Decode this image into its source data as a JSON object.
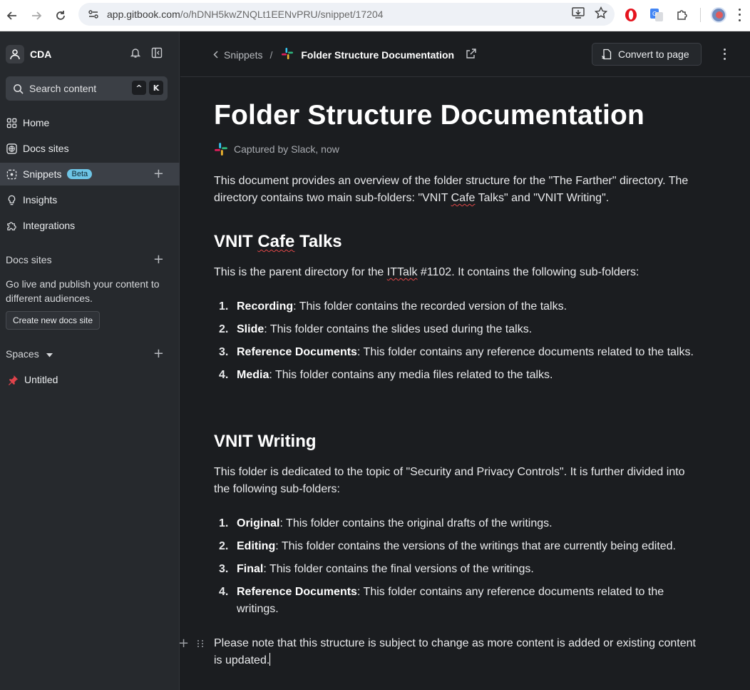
{
  "browser": {
    "url_host": "app.gitbook.com",
    "url_path": "/o/hDNH5kwZNQLt1EENvPRU/snippet/17204"
  },
  "sidebar": {
    "org_name": "CDA",
    "search_placeholder": "Search content",
    "search_kbd": [
      "^",
      "K"
    ],
    "nav": [
      {
        "label": "Home",
        "icon": "grid-icon"
      },
      {
        "label": "Docs sites",
        "icon": "globe-icon"
      },
      {
        "label": "Snippets",
        "icon": "snippet-icon",
        "badge": "Beta",
        "active": true
      },
      {
        "label": "Insights",
        "icon": "lightbulb-icon"
      },
      {
        "label": "Integrations",
        "icon": "puzzle-icon"
      }
    ],
    "docs_sites_heading": "Docs sites",
    "docs_sites_desc": "Go live and publish your content to different audiences.",
    "create_docs_site": "Create new docs site",
    "spaces_heading": "Spaces",
    "spaces": [
      {
        "label": "Untitled",
        "icon": "pushpin-icon"
      }
    ]
  },
  "topbar": {
    "breadcrumb_parent": "Snippets",
    "breadcrumb_sep": "/",
    "breadcrumb_current": "Folder Structure Documentation",
    "convert_label": "Convert to page"
  },
  "doc": {
    "title": "Folder Structure Documentation",
    "meta": "Captured by Slack, now",
    "intro_a": "This document provides an overview of the folder structure for the \"The Farther\" directory.",
    "intro_b_pre": "The directory contains two main sub-folders: \"VNIT ",
    "intro_b_sq": "Cafe",
    "intro_b_post": " Talks\" and \"VNIT Writing\".",
    "h_cafe_pre": "VNIT ",
    "h_cafe_sq": "Cafe",
    "h_cafe_post": " Talks",
    "cafe_desc_pre": "This is the parent directory for the ",
    "cafe_desc_sq": "ITTalk",
    "cafe_desc_post": " #1102. It contains the following sub-folders:",
    "cafe_items": [
      {
        "num": "1.",
        "term": "Recording",
        "text": ": This folder contains the recorded version of the talks."
      },
      {
        "num": "2.",
        "term": "Slide",
        "text": ": This folder contains the slides used during the talks."
      },
      {
        "num": "3.",
        "term": "Reference Documents",
        "text": ": This folder contains any reference documents related to the talks."
      },
      {
        "num": "4.",
        "term": "Media",
        "text": ": This folder contains any media files related to the talks."
      }
    ],
    "h_writing": "VNIT Writing",
    "writing_desc": "This folder is dedicated to the topic of \"Security and Privacy Controls\". It is further divided into the following sub-folders:",
    "writing_items": [
      {
        "num": "1.",
        "term": "Original",
        "text": ": This folder contains the original drafts of the writings."
      },
      {
        "num": "2.",
        "term": "Editing",
        "text": ": This folder contains the versions of the writings that are currently being edited."
      },
      {
        "num": "3.",
        "term": "Final",
        "text": ": This folder contains the final versions of the writings."
      },
      {
        "num": "4.",
        "term": "Reference Documents",
        "text": ": This folder contains any reference documents related to the writings."
      }
    ],
    "note": "Please note that this structure is subject to change as more content is added or existing content is updated."
  }
}
